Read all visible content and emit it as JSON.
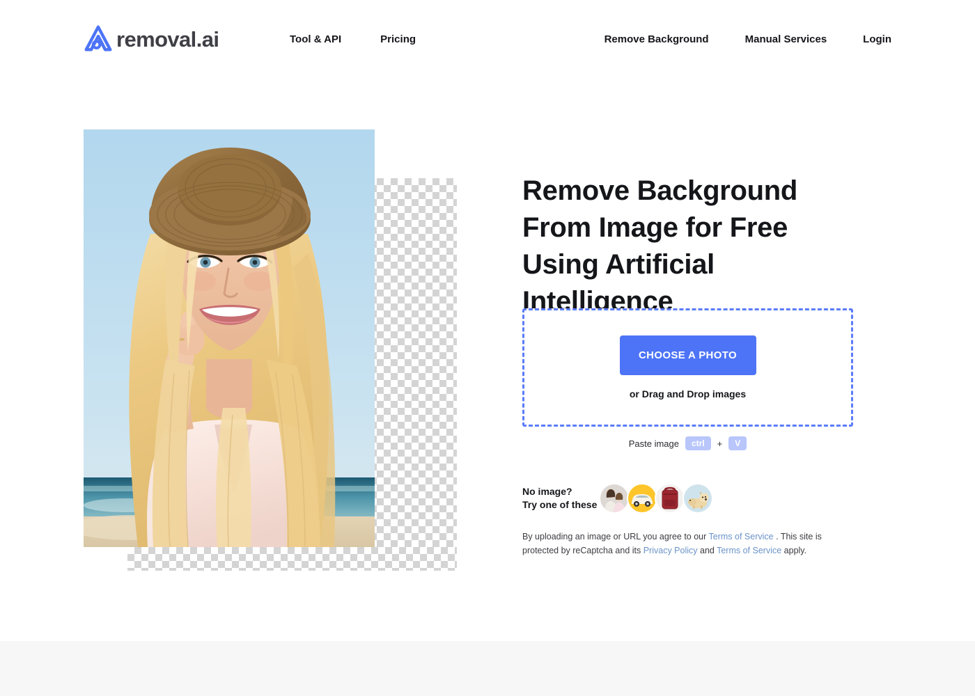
{
  "header": {
    "brand_name": "removal.ai",
    "brand_icon": "removal-ai-logo-icon",
    "nav_left": [
      {
        "label": "Tool & API"
      },
      {
        "label": "Pricing"
      }
    ],
    "nav_right": [
      {
        "label": "Remove Background"
      },
      {
        "label": "Manual Services"
      },
      {
        "label": "Login"
      }
    ]
  },
  "preview": {
    "alt": "Smiling blonde woman wearing a straw hat at the beach with background partially removed",
    "transparency_checker": "transparency-checkerboard"
  },
  "hero": {
    "title": "Remove Background From Image for Free Using Artificial Intelligence"
  },
  "dropzone": {
    "button_label": "CHOOSE A PHOTO",
    "drag_text": "or Drag and Drop images"
  },
  "paste": {
    "label": "Paste image",
    "key1": "ctrl",
    "separator": "+",
    "key2": "V"
  },
  "samples": {
    "label_line1": "No image?",
    "label_line2": "Try one of these",
    "thumbs": [
      {
        "name": "sample-thumb-couple"
      },
      {
        "name": "sample-thumb-car"
      },
      {
        "name": "sample-thumb-backpack"
      },
      {
        "name": "sample-thumb-dog"
      }
    ]
  },
  "legal": {
    "part1": "By uploading an image or URL you agree to our ",
    "link1": "Terms of Service",
    "part2": " . This site is protected by reCaptcha and its ",
    "link2": "Privacy Policy",
    "part3": " and ",
    "link3": "Terms of Service",
    "part4": " apply."
  },
  "colors": {
    "accent_blue": "#4d74f6",
    "dashed_border": "#5b7cfa",
    "kbd_badge": "#b9c6fb",
    "link_blue": "#6b93c8",
    "footer_band": "#f7f7f8",
    "text_dark": "#15161a"
  }
}
